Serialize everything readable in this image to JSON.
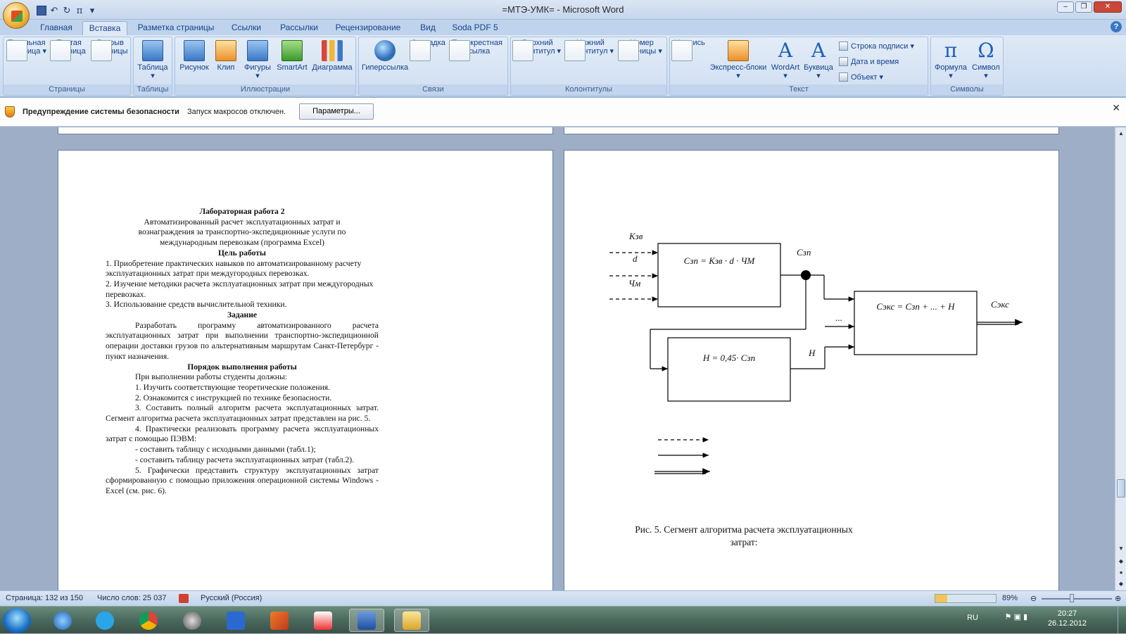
{
  "window": {
    "title": "=МТЭ-УМК= - Microsoft Word"
  },
  "qat": {
    "undo": "↶",
    "redo": "↻",
    "pi": "π"
  },
  "tabs": [
    "Главная",
    "Вставка",
    "Разметка страницы",
    "Ссылки",
    "Рассылки",
    "Рецензирование",
    "Вид",
    "Soda PDF 5"
  ],
  "ribbon": {
    "groups": [
      "Страницы",
      "Таблицы",
      "Иллюстрации",
      "Связи",
      "Колонтитулы",
      "Текст",
      "Символы"
    ],
    "buttons": {
      "title_page": [
        "Титульная",
        "страница ▾"
      ],
      "blank_page": [
        "Пустая",
        "страница"
      ],
      "page_break": [
        "Разрыв",
        "страницы"
      ],
      "table": [
        "Таблица",
        "▾"
      ],
      "picture": "Рисунок",
      "clip": "Клип",
      "shapes": [
        "Фигуры",
        "▾"
      ],
      "smartart": "SmartArt",
      "chart": "Диаграмма",
      "hyperlink": "Гиперссылка",
      "bookmark": "Закладка",
      "crossref": [
        "Перекрестная",
        "ссылка"
      ],
      "header": [
        "Верхний",
        "колонтитул ▾"
      ],
      "footer": [
        "Нижний",
        "колонтитул ▾"
      ],
      "page_number": [
        "Номер",
        "страницы ▾"
      ],
      "textbox": [
        "Надпись",
        "▾"
      ],
      "quickparts": [
        "Экспресс-блоки",
        "▾"
      ],
      "wordart": [
        "WordArt",
        "▾"
      ],
      "dropcap": [
        "Буквица",
        "▾"
      ],
      "signature_line": "Строка подписи ▾",
      "datetime": "Дата и время",
      "object": "Объект ▾",
      "equation": [
        "Формула",
        "▾"
      ],
      "symbol": [
        "Символ",
        "▾"
      ]
    }
  },
  "security": {
    "title": "Предупреждение системы безопасности",
    "message": "Запуск макросов отключен.",
    "button": "Параметры..."
  },
  "left_page": {
    "title": "Лабораторная работа 2",
    "subtitle": [
      "Автоматизированный расчет эксплуатационных затрат и",
      "вознаграждения за транспортно-экспедиционные услуги по",
      "международным перевозкам  (программа Excel)"
    ],
    "goal_heading": "Цель работы",
    "goal_items": [
      "1. Приобретение практических навыков по автоматизированному расчету эксплуатационных затрат при междугородных перевозках.",
      "2. Изучение методики расчета эксплуатационных затрат при междугородных перевозках.",
      "3. Использование средств вычислительной техники."
    ],
    "task_heading": "Задание",
    "task_text": "Разработать программу автоматизированного расчета эксплуатационных затрат при выполнении транспортно-экспедиционной операции доставки грузов по альтернативным маршрутам Санкт-Петербург - пункт назначения.",
    "order_heading": "Порядок выполнения работы",
    "order_intro": "При выполнении работы студенты должны:",
    "order_items": [
      "1. Изучить соответствующие теоретические положения.",
      "2. Ознакомится с инструкцией по технике безопасности.",
      "3. Составить полный алгоритм расчета эксплуатационных затрат. Сегмент алгоритма расчета эксплуатационных затрат представлен на рис. 5.",
      "4. Практически реализовать программу расчета эксплуатационных затрат с помощью ПЭВМ:",
      "- составить таблицу с исходными данными (табл.1);",
      "- составить таблицу расчета эксплуатационных затрат (табл.2).",
      "5. Графически представить структуру эксплуатационных затрат сформированную с помощью приложения операционной системы Windows - Excel (см. рис. 6)."
    ]
  },
  "diagram": {
    "inputs": [
      "Кзв",
      "d",
      "Чм"
    ],
    "box1_formula": "Сзп = Кзв ·  d · ЧМ",
    "node_label": "Сзп",
    "box2_formula": "Н = 0,45·  Сзп",
    "label_h": "Н",
    "dots": "...",
    "box3_formula": "Сэкс = Сзп + ... + Н",
    "output_label": "Сэкс"
  },
  "caption": [
    "Рис. 5. Сегмент алгоритма расчета эксплуатационных",
    "затрат:"
  ],
  "status": {
    "page": "Страница: 132 из 150",
    "words": "Число слов: 25 037",
    "lang": "Русский (Россия)",
    "zoom": "89%"
  },
  "tray": {
    "lang": "RU",
    "time": "20:27",
    "date": "26.12.2012"
  }
}
